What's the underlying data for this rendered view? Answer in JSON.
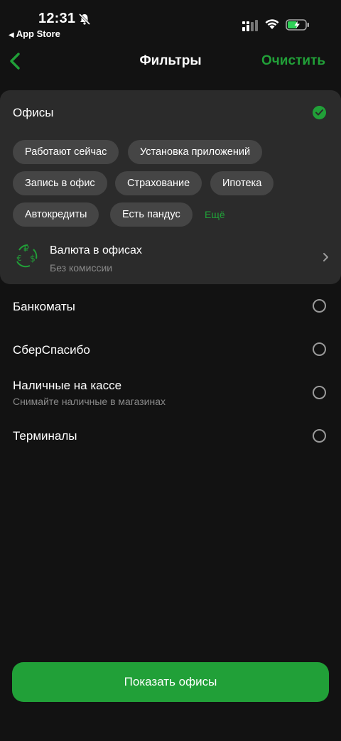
{
  "status_bar": {
    "time": "12:31",
    "back_app": "App Store"
  },
  "nav": {
    "title": "Фильтры",
    "clear_label": "Очистить"
  },
  "offices": {
    "title": "Офисы",
    "chips": [
      "Работают сейчас",
      "Установка приложений",
      "Запись в офис",
      "Страхование",
      "Ипотека",
      "Автокредиты",
      "Есть пандус"
    ],
    "more_label": "Ещё",
    "currency": {
      "title": "Валюта в офисах",
      "subtitle": "Без комиссии"
    }
  },
  "rows": [
    {
      "title": "Банкоматы",
      "subtitle": ""
    },
    {
      "title": "СберСпасибо",
      "subtitle": ""
    },
    {
      "title": "Наличные на кассе",
      "subtitle": "Снимайте наличные в магазинах"
    },
    {
      "title": "Терминалы",
      "subtitle": ""
    }
  ],
  "cta_label": "Показать офисы",
  "colors": {
    "accent": "#21a038",
    "background": "#121212",
    "card": "#2b2b2b",
    "chip": "#454545"
  }
}
